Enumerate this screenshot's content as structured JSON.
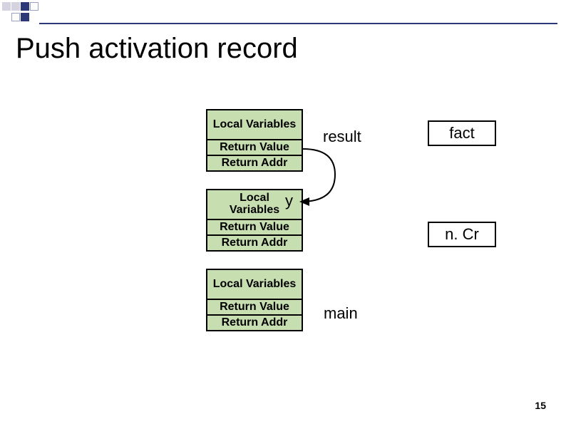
{
  "title": "Push activation record",
  "frames": [
    {
      "cells": [
        "Local Variables",
        "Return Value",
        "Return Addr"
      ]
    },
    {
      "cells": [
        "Local Variables",
        "Return Value",
        "Return Addr"
      ],
      "overlay": "y"
    },
    {
      "cells": [
        "Local Variables",
        "Return Value",
        "Return Addr"
      ]
    }
  ],
  "labels": {
    "result": "result",
    "fact": "fact",
    "ncr": "n. Cr",
    "main": "main"
  },
  "slide_number": "15"
}
